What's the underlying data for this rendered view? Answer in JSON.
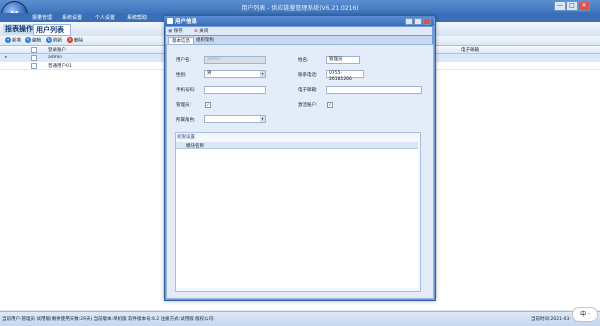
{
  "app": {
    "title": "用户列表 - 供应链量管理系统(V6.21.0216)",
    "logo_text": "M",
    "window_buttons": [
      "—",
      "□",
      "✕"
    ]
  },
  "menu": [
    "报量管理",
    "系统设置",
    "个人设置",
    "系统帮助"
  ],
  "ribbon": {
    "section": "报表操作",
    "active_tab": "用户列表"
  },
  "toolbar": [
    {
      "label": "新增",
      "icon": "add-icon",
      "color": "#2a7bd6"
    },
    {
      "label": "编辑",
      "icon": "edit-icon",
      "color": "#2a7bd6"
    },
    {
      "label": "刷新",
      "icon": "refresh-icon",
      "color": "#2a7bd6"
    },
    {
      "label": "删除",
      "icon": "delete-icon",
      "color": "#d43b2b"
    }
  ],
  "table": {
    "columns": [
      "登录账户",
      "电子邮箱"
    ],
    "rows": [
      {
        "account": "admin",
        "email": ""
      },
      {
        "account": "普通用户01",
        "email": ""
      }
    ]
  },
  "dialog": {
    "title": "用户信息",
    "save_label": "保存",
    "close_label": "关闭",
    "tabs": [
      "基本信息",
      "组织架构"
    ],
    "fields": {
      "username_label": "用户名:",
      "username_value": "admin",
      "name_label": "姓名:",
      "name_value": "管理员",
      "gender_label": "性别:",
      "gender_value": "男",
      "phone_label": "联系电话:",
      "phone_value": "0755-26181266",
      "mobile_label": "手机号码:",
      "mobile_value": "",
      "email_label": "电子邮箱:",
      "email_value": "",
      "admin_label": "管理员:",
      "admin_checked": true,
      "active_label": "激活账户:",
      "active_checked": true,
      "role_label": "所属角色:",
      "role_value": ""
    },
    "permissions": {
      "title": "权限设置",
      "column": "模块名称"
    }
  },
  "status": {
    "text": "当前用户:管理员  试用版(剩余使用天数:29天)  当前版本:单机版  软件版本号:6.2  注册方式:试用版  版权公司:",
    "time": "当前时间:2021-03-",
    "ime": "中 ·"
  }
}
